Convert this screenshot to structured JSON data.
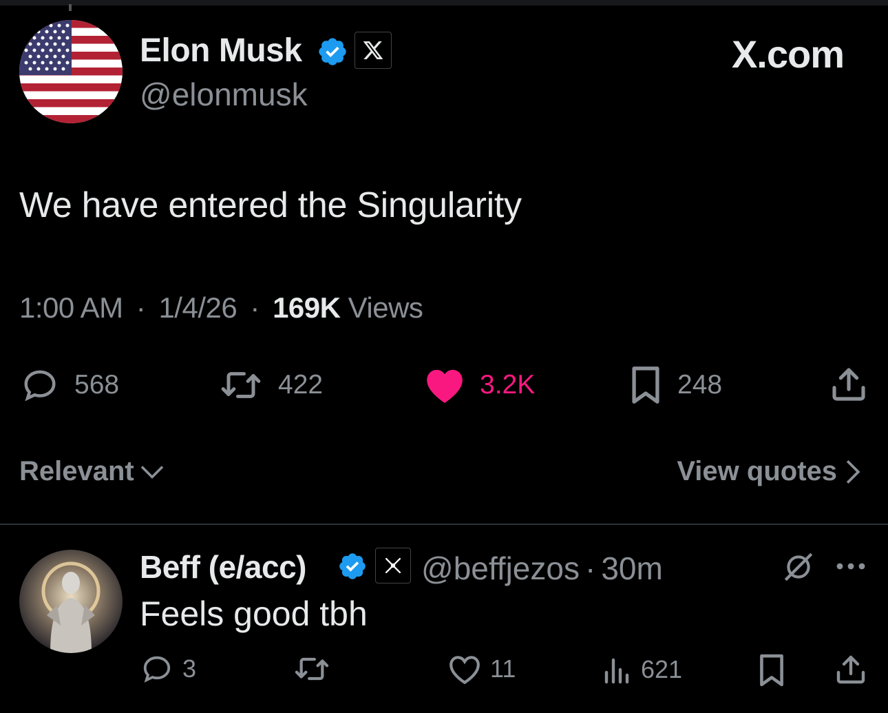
{
  "top_bar": {
    "accent": "#16181c"
  },
  "post": {
    "author_name": "Elon Musk",
    "author_handle": "@elonmusk",
    "avatar": "us-flag-avatar",
    "verified_color": "#1d9bf0",
    "site_label": "X.com",
    "text": "We have entered the Singularity",
    "time": "1:00 AM",
    "date": "1/4/26",
    "views_count": "169K",
    "views_label": "Views",
    "separator": "·",
    "actions": {
      "replies": "568",
      "reposts": "422",
      "likes": "3.2K",
      "bookmarks": "248"
    },
    "like_color": "#f91880"
  },
  "replies_bar": {
    "sort_label": "Relevant",
    "view_quotes_label": "View quotes"
  },
  "reply": {
    "author_name": "Beff (e/acc)",
    "author_handle": "@beffjezos",
    "time": "30m",
    "separator": "·",
    "text": "Feels good tbh",
    "actions": {
      "replies": "3",
      "reposts": "",
      "likes": "11",
      "views": "621"
    }
  }
}
